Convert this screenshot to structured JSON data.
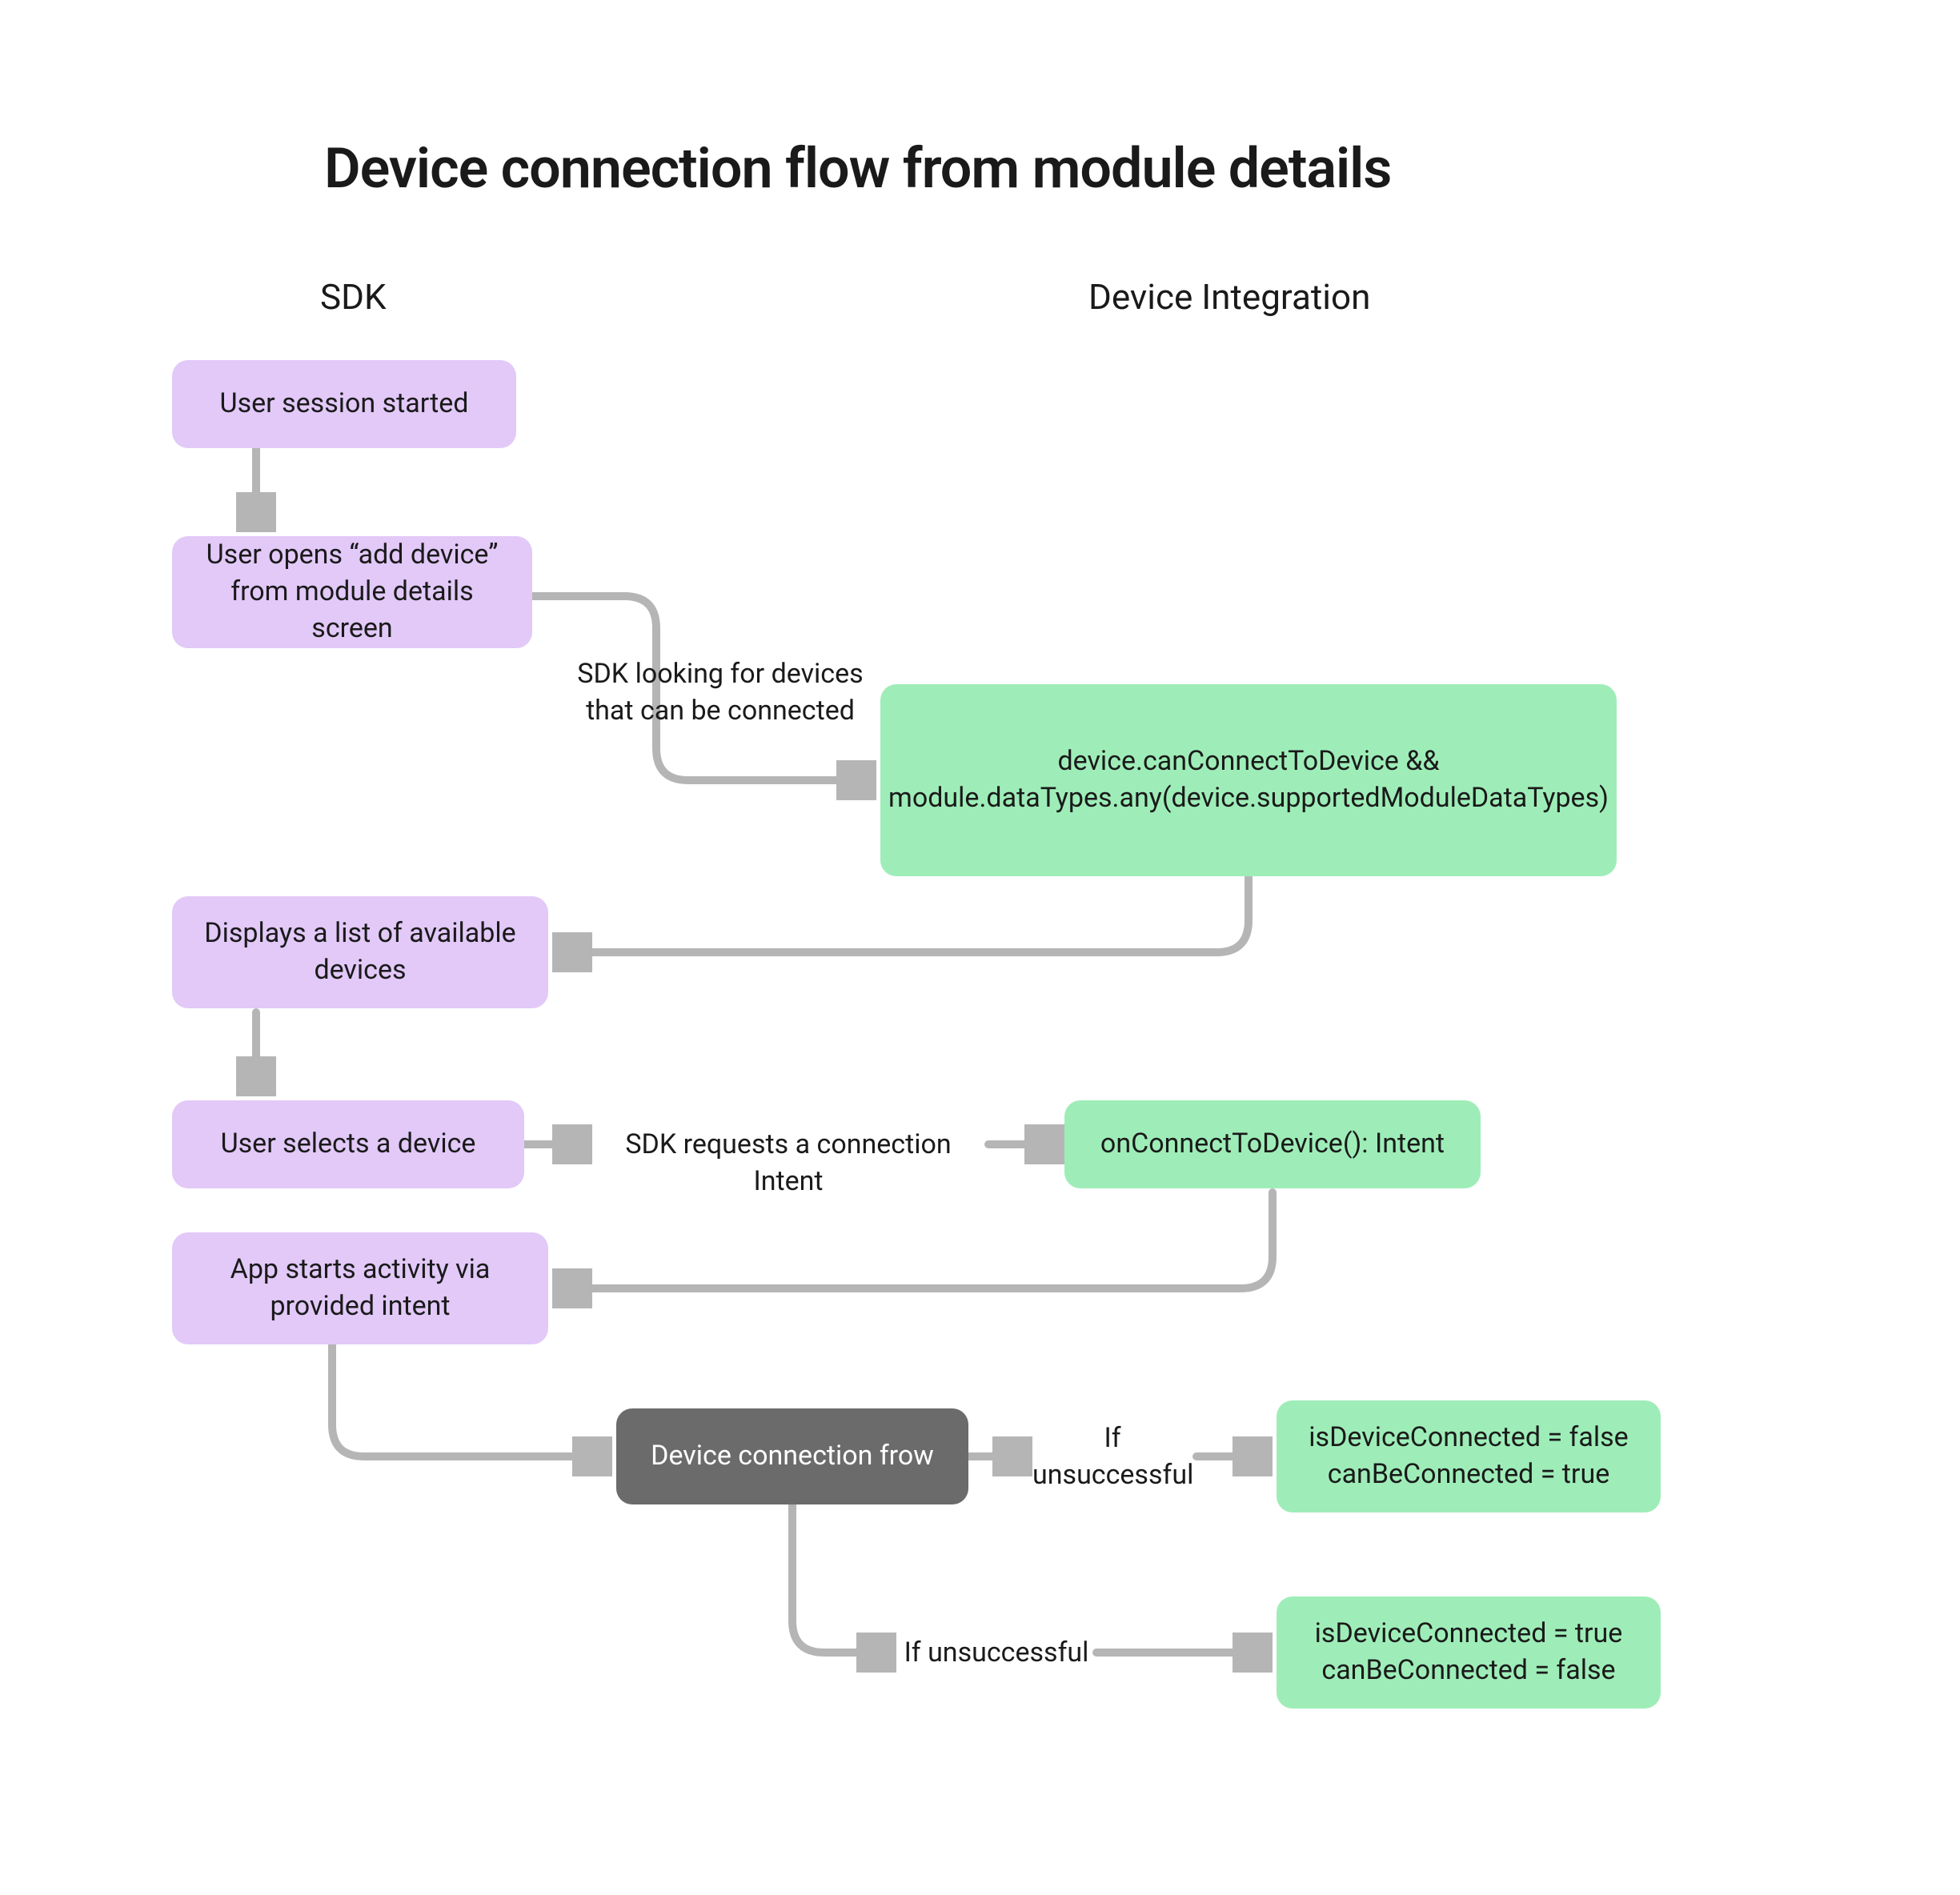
{
  "title": "Device connection flow from module details",
  "columns": {
    "left": "SDK",
    "right": "Device Integration"
  },
  "nodes": {
    "n1": "User session started",
    "n2": "User opens “add device” from module details screen",
    "n3_line1": "device.canConnectToDevice &&",
    "n3_line2": "module.dataTypes.any(device.supportedModuleDataTypes)",
    "n4": "Displays a list of available devices",
    "n5": "User selects a device",
    "n6": "onConnectToDevice(): Intent",
    "n7": "App starts activity via provided intent",
    "n8": "Device connection frow",
    "n9_line1": "isDeviceConnected = false",
    "n9_line2": "canBeConnected = true",
    "n10_line1": "isDeviceConnected = true",
    "n10_line2": "canBeConnected = false"
  },
  "edges": {
    "e1": "SDK looking for devices that can be connected",
    "e2": "SDK requests a connection Intent",
    "e3": "If unsuccessful",
    "e4": "If unsuccessful"
  },
  "colors": {
    "purple": "#E2C9F8",
    "green": "#9EEDB8",
    "dark": "#6B6B6B",
    "arrow": "#B5B5B5"
  }
}
